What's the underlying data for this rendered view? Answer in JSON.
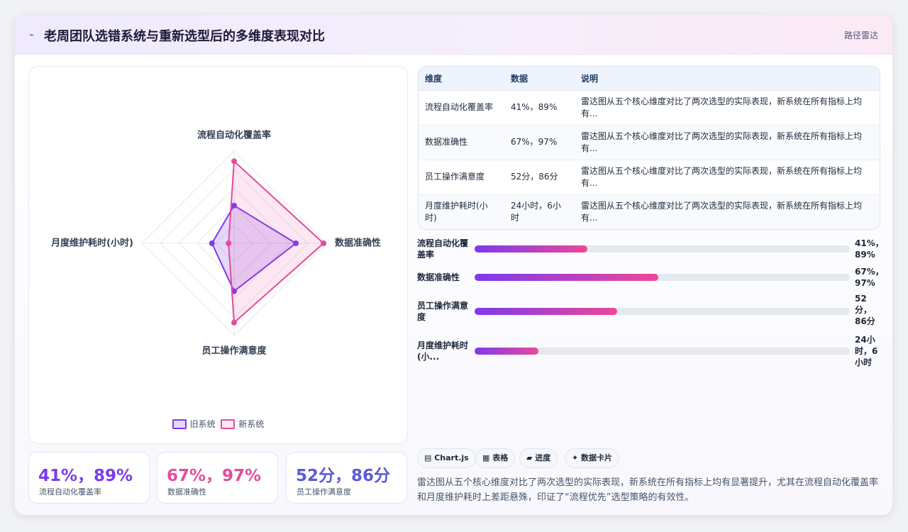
{
  "header": {
    "logo_glyph": "⌁",
    "title": "老周团队选错系统与重新选型后的多维度表现对比",
    "chart_kind": "路径雷达"
  },
  "chart_data": {
    "type": "radar",
    "axes": [
      "流程自动化覆盖率",
      "数据准确性",
      "员工操作满意度",
      "月度维护耗时(小时)"
    ],
    "series": [
      {
        "name": "旧系统",
        "values": [
          41,
          67,
          52,
          24
        ],
        "color": "#7c3aed"
      },
      {
        "name": "新系统",
        "values": [
          89,
          97,
          86,
          6
        ],
        "color": "#e24c9c"
      }
    ],
    "range": [
      0,
      100
    ],
    "rings": 5
  },
  "legend": {
    "old": "旧系统",
    "new": "新系统"
  },
  "stats": [
    {
      "value": "41%，89%",
      "label": "流程自动化覆盖率",
      "color": "#7c3aed"
    },
    {
      "value": "67%，97%",
      "label": "数据准确性",
      "color": "#e24c9c"
    },
    {
      "value": "52分，86分",
      "label": "员工操作满意度",
      "color": "#5b5bd6"
    }
  ],
  "table": {
    "headers": [
      "维度",
      "数据",
      "说明"
    ],
    "rows": [
      [
        "流程自动化覆盖率",
        "41%，89%",
        "雷达图从五个核心维度对比了两次选型的实际表现，新系统在所有指标上均有..."
      ],
      [
        "数据准确性",
        "67%，97%",
        "雷达图从五个核心维度对比了两次选型的实际表现，新系统在所有指标上均有..."
      ],
      [
        "员工操作满意度",
        "52分，86分",
        "雷达图从五个核心维度对比了两次选型的实际表现，新系统在所有指标上均有..."
      ],
      [
        "月度维护耗时(小时)",
        "24小时，6小时",
        "雷达图从五个核心维度对比了两次选型的实际表现，新系统在所有指标上均有..."
      ]
    ]
  },
  "progress": [
    {
      "label": "流程自动化覆盖率",
      "value": "41%，89%",
      "fill_pct": 30
    },
    {
      "label": "数据准确性",
      "value": "67%，97%",
      "fill_pct": 49
    },
    {
      "label": "员工操作满意度",
      "value": "52分，86分",
      "fill_pct": 38
    },
    {
      "label": "月度维护耗时(小...",
      "value": "24小时，6小时",
      "fill_pct": 17
    }
  ],
  "tags": [
    "▤ Chart.js",
    "▦ 表格",
    "▰ 进度",
    "✦ 数据卡片"
  ],
  "description": "雷达图从五个核心维度对比了两次选型的实际表现，新系统在所有指标上均有显著提升，尤其在流程自动化覆盖率和月度维护耗时上差距悬殊，印证了“流程优先”选型策略的有效性。"
}
